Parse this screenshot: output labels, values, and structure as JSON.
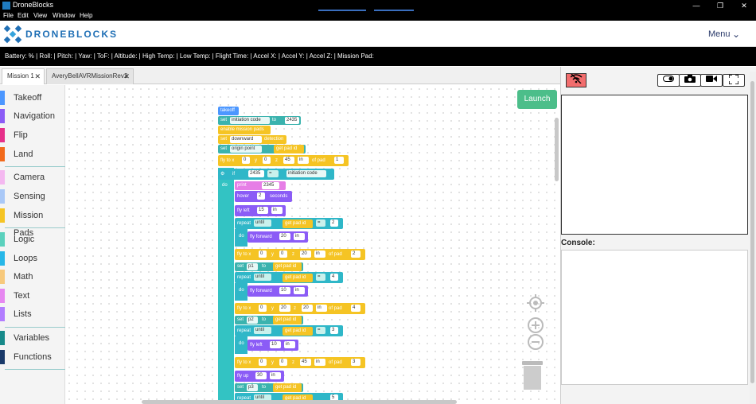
{
  "window": {
    "title": "DroneBlocks",
    "minimize": "—",
    "maximize": "❐",
    "close": "✕"
  },
  "menubar": {
    "items": [
      "File",
      "Edit",
      "View",
      "Window",
      "Help"
    ]
  },
  "header": {
    "logo_text": "DRONEBLOCKS",
    "menu_label": "Menu",
    "menu_icon": "chevron-down-icon"
  },
  "status": {
    "text": "Battery: % | Roll: | Pitch: | Yaw: | ToF: | Altitude: | High Temp: | Low Temp: | Flight Time: | Accel X: | Accel Y: | Accel Z: | Mission Pad:"
  },
  "tabs": [
    {
      "label": "Mission 1",
      "close": "✕"
    },
    {
      "label": "AveryBellAVRMissionRev2",
      "close": "✕"
    }
  ],
  "sidebar": {
    "items": [
      {
        "label": "Takeoff",
        "color": "#4c97ff"
      },
      {
        "label": "Navigation",
        "color": "#8b5cf6"
      },
      {
        "label": "Flip",
        "color": "#e6308a"
      },
      {
        "label": "Land",
        "color": "#f26a1b"
      },
      {
        "label": "Camera",
        "color": "#f4b8f0"
      },
      {
        "label": "Sensing",
        "color": "#a9c8f7"
      },
      {
        "label": "Mission Pads",
        "color": "#f5c424"
      },
      {
        "label": "Logic",
        "color": "#5bd1bd"
      },
      {
        "label": "Loops",
        "color": "#27b7e8"
      },
      {
        "label": "Math",
        "color": "#f7c97c"
      },
      {
        "label": "Text",
        "color": "#e687f0"
      },
      {
        "label": "Lists",
        "color": "#b27dff"
      },
      {
        "label": "Variables",
        "color": "#178a8a"
      },
      {
        "label": "Functions",
        "color": "#1a3a6a"
      }
    ]
  },
  "workspace": {
    "launch_label": "Launch",
    "blocks": {
      "takeoff": "takeoff",
      "set1": "set",
      "initiation_code": "initiation code",
      "to": "to",
      "v2435": "2435",
      "enable_pads": "enable mission pads",
      "set_dir": "set",
      "downward": "downward",
      "detection": "detection",
      "set_origin": "set",
      "origin_point": "origin point",
      "get_pad_id": "get pad id",
      "fly_to_x": "fly to x",
      "x0": "0",
      "y": "y",
      "y0": "0",
      "z": "z",
      "z45": "45",
      "in": "in",
      "of_pad": "of pad",
      "pad1": "1",
      "if": "if",
      "v2435b": "2435",
      "eq": "=",
      "init_code_ref": "initiation code",
      "do": "do",
      "print": "print",
      "v2345": "2345",
      "hover": "hover",
      "h2": "2",
      "seconds": "seconds",
      "fly_left": "fly left",
      "fl15": "15",
      "fl_in": "in",
      "repeat_until": "repeat",
      "until": "until",
      "get_pad_id2": "get pad id",
      "eq2": "=",
      "pad2": "2",
      "do2": "do",
      "fly_forward": "fly forward",
      "ff20": "20",
      "ff_in": "in",
      "fly_to_x2": "fly to x",
      "x0b": "0",
      "yb": "y",
      "y0b": "0",
      "zb": "z",
      "z20": "20",
      "inb": "in",
      "of_pad2": "of pad",
      "pad2b": "2",
      "set_p1": "set",
      "p1": "p1",
      "to_p1": "to",
      "get_pad_id3": "get pad id",
      "repeat2": "repeat",
      "until2": "until",
      "get_pad_id4": "get pad id",
      "eq3": "=",
      "pad4": "4",
      "do3": "do",
      "fly_forward2": "fly forward",
      "ff10": "10",
      "ff_in2": "in",
      "fly_to_x3": "fly to x",
      "x0c": "0",
      "yc": "y",
      "y20": "20",
      "zc": "z",
      "z20c": "20",
      "inc": "in",
      "of_pad3": "of pad",
      "pad4b": "4",
      "set_p2": "set",
      "p2": "p2",
      "to_p2": "to",
      "get_pad_id5": "get pad id",
      "repeat3": "repeat",
      "until3": "until",
      "get_pad_id6": "get pad id",
      "eq4": "=",
      "pad3": "3",
      "do4": "do",
      "fly_left2": "fly left",
      "fl10": "10",
      "fl_in2": "in",
      "fly_to_x4": "fly to x",
      "x0d": "0",
      "yd": "y",
      "y0d": "0",
      "zd": "z",
      "z45d": "45",
      "ind": "in",
      "of_pad4": "of pad",
      "pad3b": "3",
      "fly_up": "fly up",
      "fu30": "30",
      "fu_in": "in",
      "set_p3": "set",
      "p3": "p3",
      "to_p3": "to",
      "get_pad_id7": "get pad id",
      "repeat4": "repeat",
      "until4": "until",
      "get_pad_id8": "get pad id",
      "pad5": "5"
    }
  },
  "right_panel": {
    "buttons": [
      "wifi-off-icon",
      "toggle-icon",
      "camera-icon",
      "video-icon",
      "fullscreen-icon"
    ],
    "console_label": "Console:"
  }
}
